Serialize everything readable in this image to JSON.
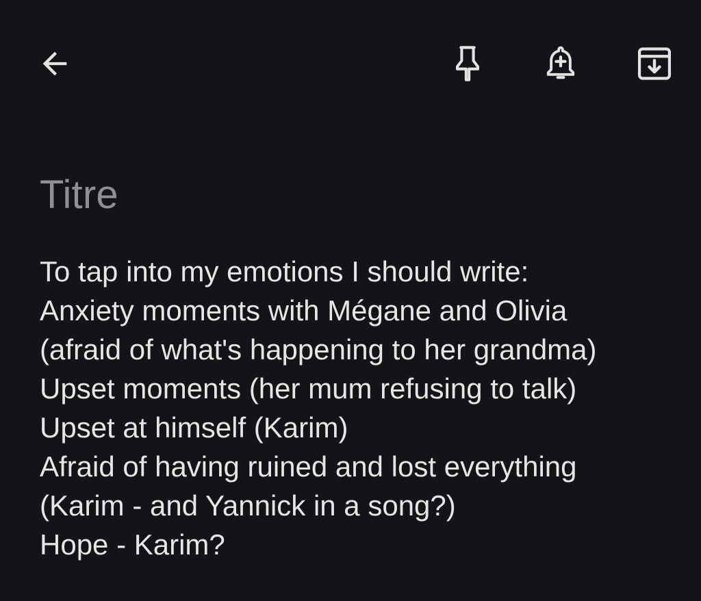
{
  "toolbar": {
    "back_icon": "arrow-left-icon",
    "pin_icon": "pin-icon",
    "reminder_icon": "bell-plus-icon",
    "archive_icon": "archive-icon",
    "icon_color": "#e3e3e3"
  },
  "note": {
    "title_placeholder": "Titre",
    "lines": [
      "To tap into my emotions I should write:",
      "Anxiety moments with Mégane and Olivia",
      "(afraid of what's happening to her grandma)",
      "Upset moments (her mum refusing to talk)",
      "Upset at himself (Karim)",
      "Afraid of having ruined and lost everything",
      "(Karim - and Yannick in a song?)",
      "Hope - Karim?"
    ]
  },
  "colors": {
    "background": "#131417",
    "title_placeholder": "#8f9093",
    "body_text": "#e6e6e6"
  }
}
